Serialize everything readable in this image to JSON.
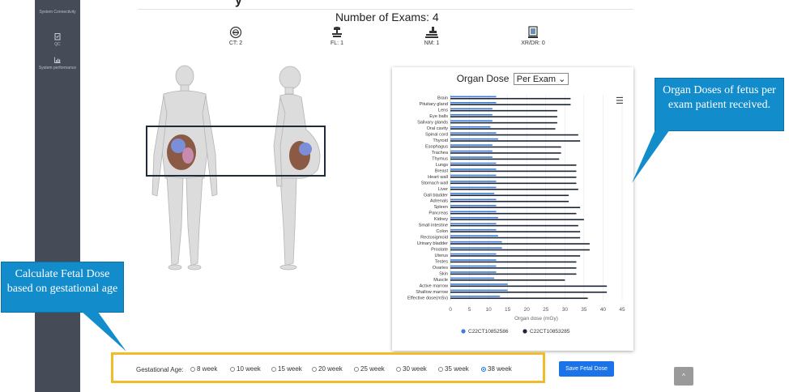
{
  "sidebar": {
    "items": [
      {
        "label": "System Connectivity",
        "icon": "network-icon"
      },
      {
        "label": "QC",
        "icon": "clipboard-icon"
      },
      {
        "label": "System performance",
        "icon": "bar-chart-icon"
      }
    ]
  },
  "header": {
    "cut_title": "y",
    "exams_title": "Number of Exams: 4"
  },
  "modalities": [
    {
      "label": "CT: 2",
      "icon": "ct-scanner-icon"
    },
    {
      "label": "FL: 1",
      "icon": "fluoroscopy-icon"
    },
    {
      "label": "NM: 1",
      "icon": "nuclear-medicine-icon"
    },
    {
      "label": "XR/DR: 0",
      "icon": "xray-icon"
    }
  ],
  "chart_panel": {
    "title": "Organ Dose",
    "select_value": "Per Exam",
    "menu_icon": "hamburger-icon"
  },
  "chart_data": {
    "type": "bar",
    "orientation": "horizontal",
    "categories": [
      "Brain",
      "Pituitary gland",
      "Lens",
      "Eye balls",
      "Salivary glands",
      "Oral cavity",
      "Spinal cord",
      "Thyroid",
      "Esophagus",
      "Trachea",
      "Thymus",
      "Lungs",
      "Breast",
      "Heart wall",
      "Stomach wall",
      "Liver",
      "Gall bladder",
      "Adrenals",
      "Spleen",
      "Pancreas",
      "Kidney",
      "Small intestine",
      "Colon",
      "Rectosigmoid",
      "Urinary bladder",
      "Prostate",
      "Uterus",
      "Testes",
      "Ovaries",
      "Skin",
      "Muscle",
      "Active marrow",
      "Shallow marrow",
      "Effective dose(mSv)"
    ],
    "series": [
      {
        "name": "C22CT10852586",
        "color": "#3b7dd8",
        "values": [
          12,
          12,
          11,
          11,
          11,
          10.5,
          12,
          12.5,
          11,
          11,
          11,
          12,
          12,
          12,
          12,
          12,
          11.5,
          12,
          12,
          12,
          12.5,
          12,
          12,
          12.5,
          13.5,
          13.5,
          12,
          12,
          12,
          12,
          11.5,
          15,
          15,
          13
        ]
      },
      {
        "name": "C22CT10853285",
        "color": "#1c2535",
        "values": [
          31.5,
          31.5,
          28,
          28,
          28,
          27.5,
          33.5,
          34,
          29,
          29,
          28.5,
          33,
          33,
          33,
          33,
          33.5,
          31,
          31,
          34,
          33,
          35,
          33.5,
          34,
          34,
          36.5,
          36.5,
          34,
          33,
          33,
          33,
          30,
          41,
          41,
          36
        ]
      }
    ],
    "xlabel": "Organ dose (mGy)",
    "xlim": [
      0,
      45
    ],
    "xticks": [
      0,
      5,
      10,
      15,
      20,
      25,
      30,
      35,
      40,
      45
    ],
    "grid": true,
    "legend_position": "bottom"
  },
  "callouts": {
    "left": "Calculate Fetal Dose based on gestational age",
    "right": "Organ Doses of fetus per exam patient received."
  },
  "gestational": {
    "label": "Gestational Age:",
    "options": [
      "8 week",
      "10 week",
      "15 week",
      "20 week",
      "25 week",
      "30 week",
      "35 week",
      "38 week"
    ],
    "selected": "38 week",
    "save_label": "Save Fetal Dose"
  },
  "scroll_top_label": "^"
}
